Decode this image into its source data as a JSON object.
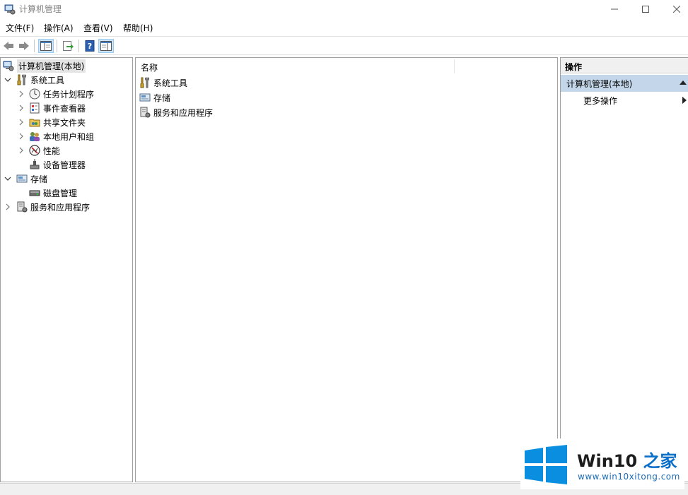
{
  "window": {
    "title": "计算机管理",
    "controls": {
      "minimize": "—",
      "maximize": "☐",
      "close": "✕"
    }
  },
  "menubar": {
    "items": [
      {
        "label": "文件(F)"
      },
      {
        "label": "操作(A)"
      },
      {
        "label": "查看(V)"
      },
      {
        "label": "帮助(H)"
      }
    ]
  },
  "toolbar": {
    "buttons": [
      "back-icon",
      "forward-icon",
      "console-tree-icon",
      "export-list-icon",
      "help-icon",
      "action-pane-icon"
    ]
  },
  "tree": {
    "root": {
      "label": "计算机管理(本地)",
      "icon": "computer-management-icon"
    },
    "system_tools": {
      "label": "系统工具",
      "icon": "tools-icon",
      "children": [
        {
          "label": "任务计划程序",
          "icon": "clock-icon",
          "expandable": true
        },
        {
          "label": "事件查看器",
          "icon": "event-viewer-icon",
          "expandable": true
        },
        {
          "label": "共享文件夹",
          "icon": "shared-folder-icon",
          "expandable": true
        },
        {
          "label": "本地用户和组",
          "icon": "users-icon",
          "expandable": true
        },
        {
          "label": "性能",
          "icon": "performance-icon",
          "expandable": true
        },
        {
          "label": "设备管理器",
          "icon": "device-manager-icon",
          "expandable": false
        }
      ]
    },
    "storage": {
      "label": "存储",
      "icon": "storage-icon",
      "children": [
        {
          "label": "磁盘管理",
          "icon": "disk-icon",
          "expandable": false
        }
      ]
    },
    "services": {
      "label": "服务和应用程序",
      "icon": "services-icon"
    }
  },
  "center": {
    "column_header": "名称",
    "rows": [
      {
        "label": "系统工具",
        "icon": "tools-icon"
      },
      {
        "label": "存储",
        "icon": "storage-icon"
      },
      {
        "label": "服务和应用程序",
        "icon": "services-icon"
      }
    ]
  },
  "actions": {
    "header": "操作",
    "section_title": "计算机管理(本地)",
    "more_actions": "更多操作"
  },
  "watermark": {
    "title_main": "Win10 ",
    "title_accent": "之家",
    "url": "www.win10xitong.com"
  },
  "colors": {
    "selection_bg": "#e5e5e5",
    "action_section_bg": "#c4d7ea",
    "watermark_blue": "#0a6fc9"
  }
}
